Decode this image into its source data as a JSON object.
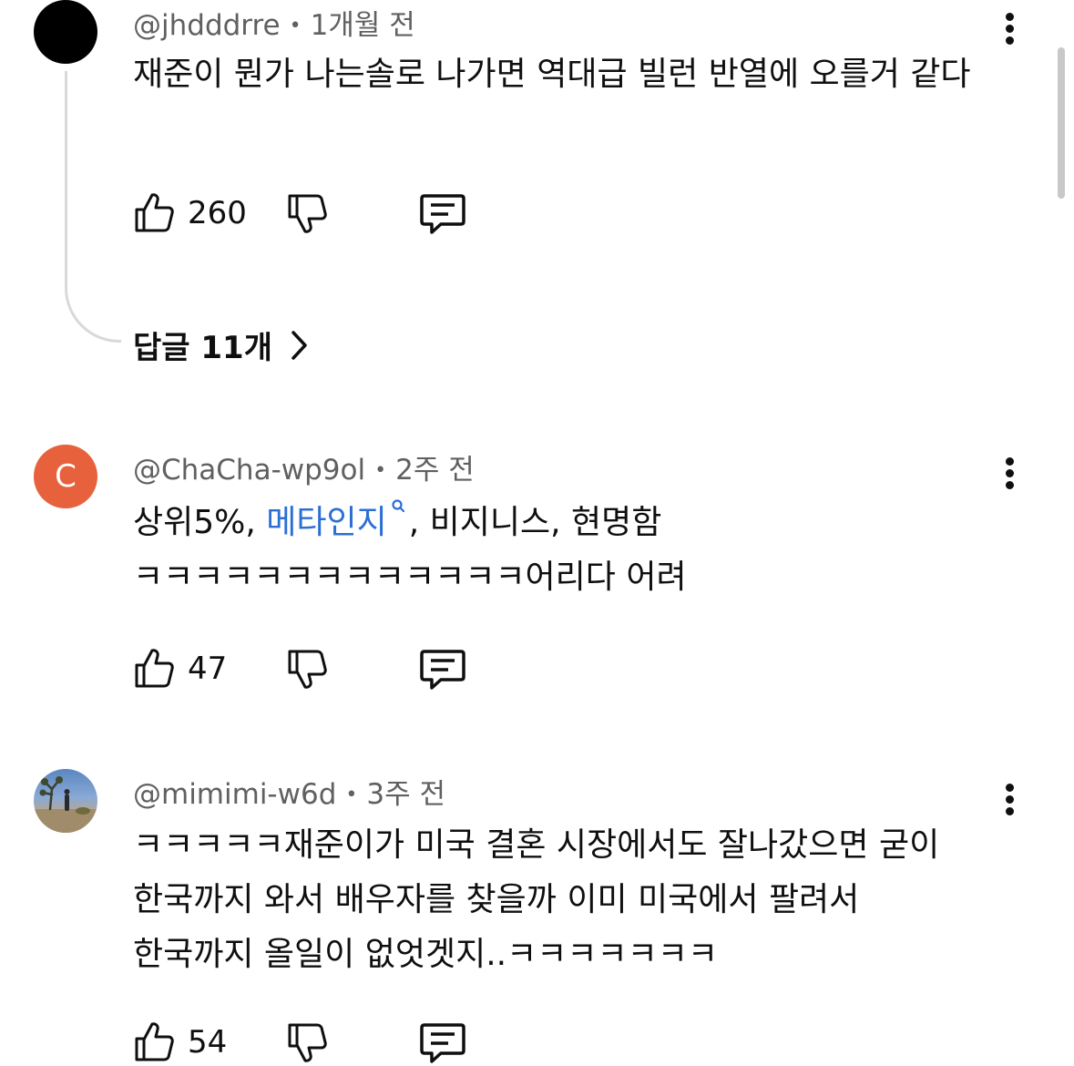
{
  "comments": [
    {
      "author": "@jhdddrre",
      "time": "1개월 전",
      "text": "재준이 뭔가 나는솔로 나가면 역대급 빌런 반열에 오를거 같다",
      "likes": "260",
      "avatar_letter": "",
      "replies_label": "답글 11개"
    },
    {
      "author": "@ChaCha-wp9ol",
      "time": "2주 전",
      "text_before": "상위5%, ",
      "link_text": "메타인지",
      "text_after": ", 비지니스, 현명함 ㅋㅋㅋㅋㅋㅋㅋㅋㅋㅋㅋㅋㅋ어리다 어려",
      "likes": "47",
      "avatar_letter": "C"
    },
    {
      "author": "@mimimi-w6d",
      "time": "3주 전",
      "text": "ㅋㅋㅋㅋㅋ재준이가 미국 결혼 시장에서도 잘나갔으면 굳이 한국까지 와서 배우자를 찾을까 이미 미국에서 팔려서 한국까지 올일이 없엇겟지..ㅋㅋㅋㅋㅋㅋㅋ",
      "likes": "54",
      "avatar_letter": ""
    }
  ],
  "colors": {
    "link": "#2b6fd4",
    "avatar_c": "#e8613d",
    "meta_text": "#606060"
  },
  "icons": [
    "like-icon",
    "dislike-icon",
    "reply-icon",
    "more-icon",
    "search-icon",
    "chevron-right-icon"
  ]
}
